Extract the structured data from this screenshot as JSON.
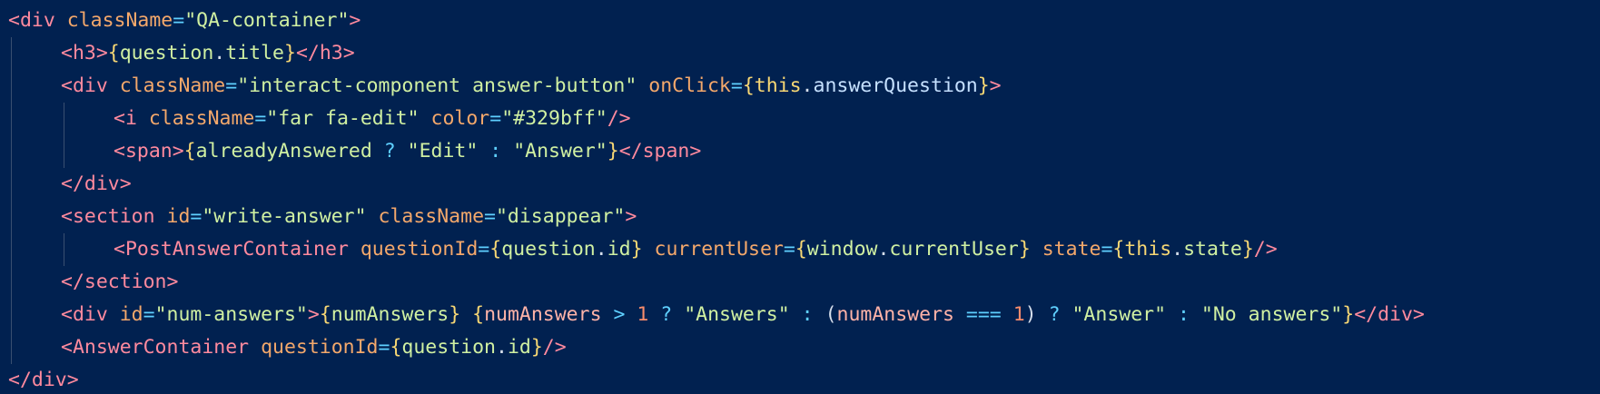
{
  "editor": {
    "theme": "dark-navy",
    "background": "#012150",
    "lines": [
      {
        "indent": 0,
        "tokens": [
          {
            "t": "<div ",
            "c": "tag"
          },
          {
            "t": "className",
            "c": "attr"
          },
          {
            "t": "=",
            "c": "op"
          },
          {
            "t": "\"QA-container\"",
            "c": "str"
          },
          {
            "t": ">",
            "c": "tag"
          }
        ]
      },
      {
        "indent": 1,
        "tokens": [
          {
            "t": "<h3>",
            "c": "tag"
          },
          {
            "t": "{",
            "c": "brace"
          },
          {
            "t": "question",
            "c": "str"
          },
          {
            "t": ".",
            "c": "plain"
          },
          {
            "t": "title",
            "c": "str"
          },
          {
            "t": "}",
            "c": "brace"
          },
          {
            "t": "</h3>",
            "c": "tag"
          }
        ]
      },
      {
        "indent": 1,
        "tokens": [
          {
            "t": "<div ",
            "c": "tag"
          },
          {
            "t": "className",
            "c": "attr"
          },
          {
            "t": "=",
            "c": "op"
          },
          {
            "t": "\"interact-component answer-button\"",
            "c": "str"
          },
          {
            "t": " ",
            "c": "plain"
          },
          {
            "t": "onClick",
            "c": "attr"
          },
          {
            "t": "=",
            "c": "op"
          },
          {
            "t": "{",
            "c": "brace"
          },
          {
            "t": "this",
            "c": "kw"
          },
          {
            "t": ".",
            "c": "plain"
          },
          {
            "t": "answerQuestion",
            "c": "prop"
          },
          {
            "t": "}",
            "c": "brace"
          },
          {
            "t": ">",
            "c": "tag"
          }
        ]
      },
      {
        "indent": 2,
        "tokens": [
          {
            "t": "<i ",
            "c": "tag"
          },
          {
            "t": "className",
            "c": "attr"
          },
          {
            "t": "=",
            "c": "op"
          },
          {
            "t": "\"far fa-edit\"",
            "c": "str"
          },
          {
            "t": " ",
            "c": "plain"
          },
          {
            "t": "color",
            "c": "attr"
          },
          {
            "t": "=",
            "c": "op"
          },
          {
            "t": "\"#329bff\"",
            "c": "str"
          },
          {
            "t": "/>",
            "c": "tag"
          }
        ]
      },
      {
        "indent": 2,
        "tokens": [
          {
            "t": "<span>",
            "c": "tag"
          },
          {
            "t": "{",
            "c": "brace"
          },
          {
            "t": "alreadyAnswered",
            "c": "str"
          },
          {
            "t": " ",
            "c": "plain"
          },
          {
            "t": "?",
            "c": "op"
          },
          {
            "t": " ",
            "c": "plain"
          },
          {
            "t": "\"Edit\"",
            "c": "str"
          },
          {
            "t": " ",
            "c": "plain"
          },
          {
            "t": ":",
            "c": "op"
          },
          {
            "t": " ",
            "c": "plain"
          },
          {
            "t": "\"Answer\"",
            "c": "str"
          },
          {
            "t": "}",
            "c": "brace"
          },
          {
            "t": "</span>",
            "c": "tag"
          }
        ]
      },
      {
        "indent": 1,
        "tokens": [
          {
            "t": "</div>",
            "c": "tag"
          }
        ]
      },
      {
        "indent": 1,
        "tokens": [
          {
            "t": "<section ",
            "c": "tag"
          },
          {
            "t": "id",
            "c": "attr"
          },
          {
            "t": "=",
            "c": "op"
          },
          {
            "t": "\"write-answer\"",
            "c": "str"
          },
          {
            "t": " ",
            "c": "plain"
          },
          {
            "t": "className",
            "c": "attr"
          },
          {
            "t": "=",
            "c": "op"
          },
          {
            "t": "\"disappear\"",
            "c": "str"
          },
          {
            "t": ">",
            "c": "tag"
          }
        ]
      },
      {
        "indent": 2,
        "tokens": [
          {
            "t": "<PostAnswerContainer ",
            "c": "tag"
          },
          {
            "t": "questionId",
            "c": "attr"
          },
          {
            "t": "=",
            "c": "op"
          },
          {
            "t": "{",
            "c": "brace"
          },
          {
            "t": "question",
            "c": "str"
          },
          {
            "t": ".",
            "c": "plain"
          },
          {
            "t": "id",
            "c": "str"
          },
          {
            "t": "}",
            "c": "brace"
          },
          {
            "t": " ",
            "c": "plain"
          },
          {
            "t": "currentUser",
            "c": "attr"
          },
          {
            "t": "=",
            "c": "op"
          },
          {
            "t": "{",
            "c": "brace"
          },
          {
            "t": "window",
            "c": "str"
          },
          {
            "t": ".",
            "c": "plain"
          },
          {
            "t": "currentUser",
            "c": "str"
          },
          {
            "t": "}",
            "c": "brace"
          },
          {
            "t": " ",
            "c": "plain"
          },
          {
            "t": "state",
            "c": "attr"
          },
          {
            "t": "=",
            "c": "op"
          },
          {
            "t": "{",
            "c": "brace"
          },
          {
            "t": "this",
            "c": "kw"
          },
          {
            "t": ".",
            "c": "plain"
          },
          {
            "t": "state",
            "c": "str"
          },
          {
            "t": "}",
            "c": "brace"
          },
          {
            "t": "/>",
            "c": "tag"
          }
        ]
      },
      {
        "indent": 1,
        "tokens": [
          {
            "t": "</section>",
            "c": "tag"
          }
        ]
      },
      {
        "indent": 1,
        "tokens": [
          {
            "t": "<div ",
            "c": "tag"
          },
          {
            "t": "id",
            "c": "attr"
          },
          {
            "t": "=",
            "c": "op"
          },
          {
            "t": "\"num-answers\"",
            "c": "str"
          },
          {
            "t": ">",
            "c": "tag"
          },
          {
            "t": "{",
            "c": "brace"
          },
          {
            "t": "numAnswers",
            "c": "str"
          },
          {
            "t": "}",
            "c": "brace"
          },
          {
            "t": " ",
            "c": "plain"
          },
          {
            "t": "{",
            "c": "brace"
          },
          {
            "t": "numAnswers",
            "c": "var"
          },
          {
            "t": " ",
            "c": "plain"
          },
          {
            "t": ">",
            "c": "op"
          },
          {
            "t": " ",
            "c": "plain"
          },
          {
            "t": "1",
            "c": "num"
          },
          {
            "t": " ",
            "c": "plain"
          },
          {
            "t": "?",
            "c": "op"
          },
          {
            "t": " ",
            "c": "plain"
          },
          {
            "t": "\"Answers\"",
            "c": "str"
          },
          {
            "t": " ",
            "c": "plain"
          },
          {
            "t": ":",
            "c": "op"
          },
          {
            "t": " ",
            "c": "plain"
          },
          {
            "t": "(",
            "c": "plain"
          },
          {
            "t": "numAnswers",
            "c": "var"
          },
          {
            "t": " ",
            "c": "plain"
          },
          {
            "t": "===",
            "c": "op"
          },
          {
            "t": " ",
            "c": "plain"
          },
          {
            "t": "1",
            "c": "num"
          },
          {
            "t": ")",
            "c": "plain"
          },
          {
            "t": " ",
            "c": "plain"
          },
          {
            "t": "?",
            "c": "op"
          },
          {
            "t": " ",
            "c": "plain"
          },
          {
            "t": "\"Answer\"",
            "c": "str"
          },
          {
            "t": " ",
            "c": "plain"
          },
          {
            "t": ":",
            "c": "op"
          },
          {
            "t": " ",
            "c": "plain"
          },
          {
            "t": "\"No answers\"",
            "c": "str"
          },
          {
            "t": "}",
            "c": "brace"
          },
          {
            "t": "</div>",
            "c": "tag"
          }
        ]
      },
      {
        "indent": 1,
        "tokens": [
          {
            "t": "<AnswerContainer ",
            "c": "tag"
          },
          {
            "t": "questionId",
            "c": "attr"
          },
          {
            "t": "=",
            "c": "op"
          },
          {
            "t": "{",
            "c": "brace"
          },
          {
            "t": "question",
            "c": "str"
          },
          {
            "t": ".",
            "c": "plain"
          },
          {
            "t": "id",
            "c": "str"
          },
          {
            "t": "}",
            "c": "brace"
          },
          {
            "t": "/>",
            "c": "tag"
          }
        ]
      },
      {
        "indent": 0,
        "tokens": [
          {
            "t": "</div>",
            "c": "tag"
          }
        ]
      }
    ]
  }
}
